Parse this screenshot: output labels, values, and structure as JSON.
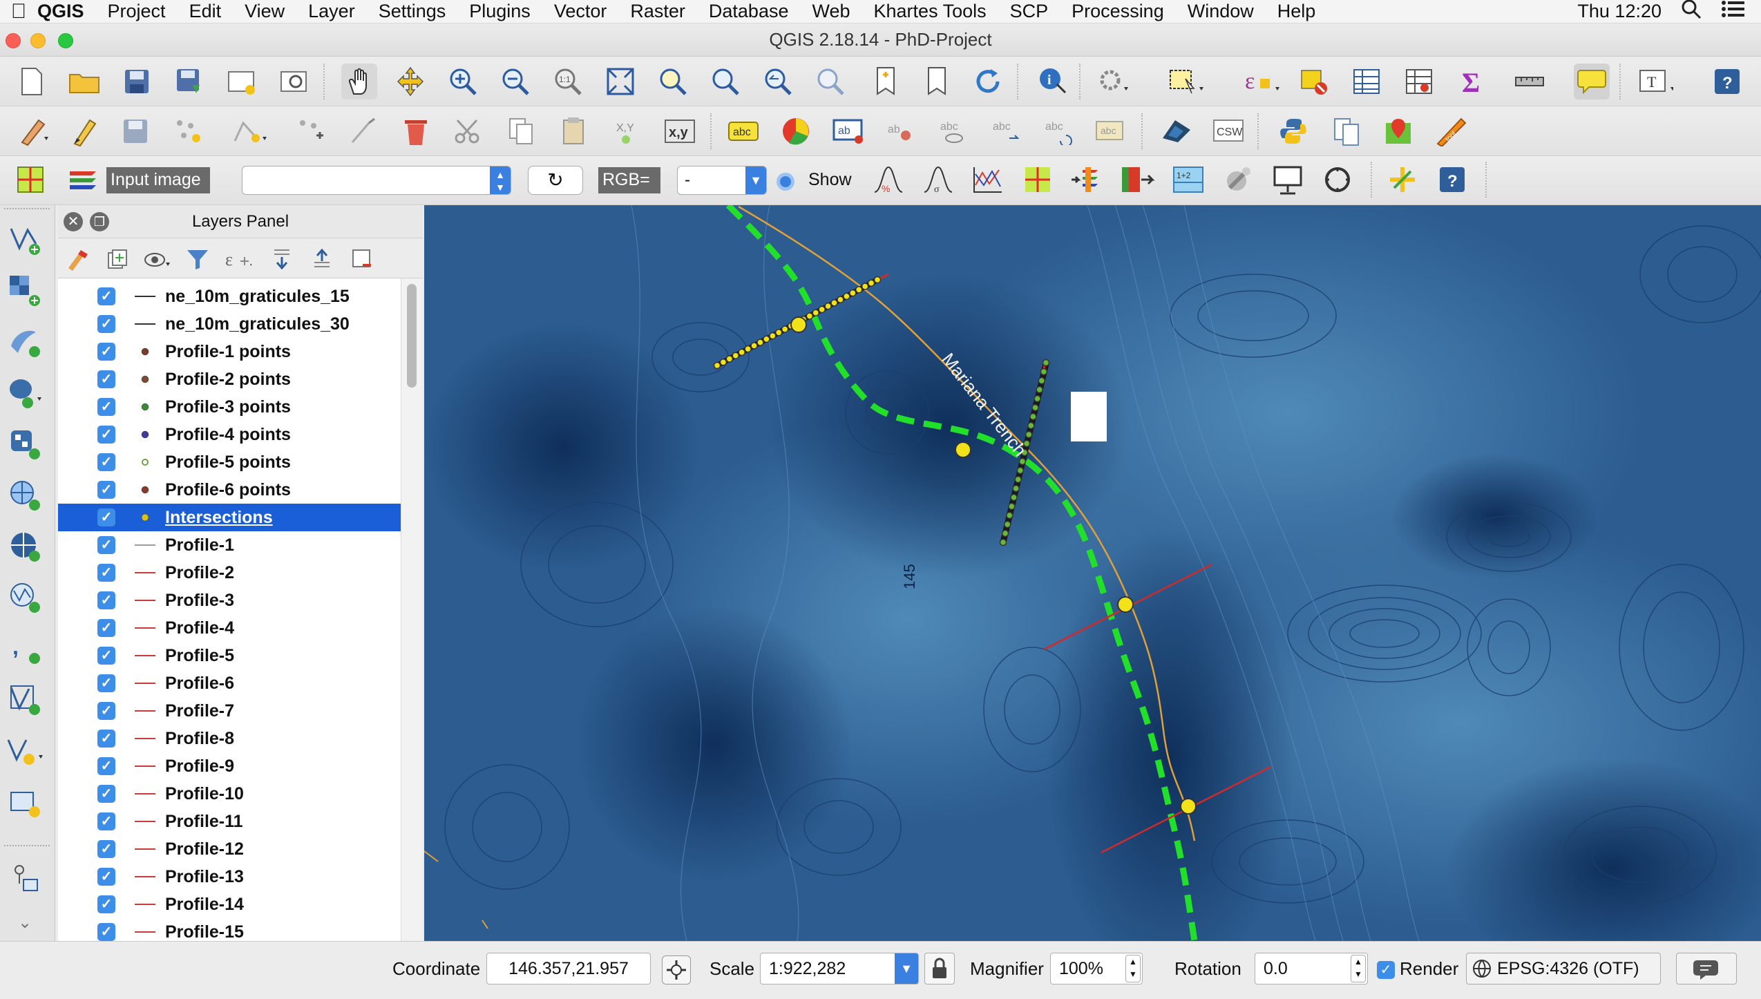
{
  "menubar": {
    "app": "QGIS",
    "items": [
      "Project",
      "Edit",
      "View",
      "Layer",
      "Settings",
      "Plugins",
      "Vector",
      "Raster",
      "Database",
      "Web",
      "Khartes Tools",
      "SCP",
      "Processing",
      "Window",
      "Help"
    ],
    "clock": "Thu 12:20"
  },
  "window": {
    "title": "QGIS 2.18.14 - PhD-Project"
  },
  "scp_toolbar": {
    "input_label": "Input image",
    "input_value": "",
    "rgb_label": "RGB=",
    "rgb_value": "-",
    "show_label": "Show"
  },
  "layers_panel": {
    "title": "Layers Panel",
    "layers": [
      {
        "name": "ne_10m_graticules_15",
        "symbol": "line",
        "color": "#333333",
        "checked": true
      },
      {
        "name": "ne_10m_graticules_30",
        "symbol": "line",
        "color": "#333333",
        "checked": true
      },
      {
        "name": "Profile-1 points",
        "symbol": "point",
        "color": "#7a3b2a",
        "checked": true
      },
      {
        "name": "Profile-2 points",
        "symbol": "point",
        "color": "#7a4a35",
        "checked": true
      },
      {
        "name": "Profile-3 points",
        "symbol": "point",
        "color": "#3a8a3a",
        "checked": true
      },
      {
        "name": "Profile-4 points",
        "symbol": "point",
        "color": "#3d3a9a",
        "checked": true
      },
      {
        "name": "Profile-5 points",
        "symbol": "point-open",
        "color": "#6ea542",
        "checked": true
      },
      {
        "name": "Profile-6 points",
        "symbol": "point",
        "color": "#8a3a2a",
        "checked": true
      },
      {
        "name": "Intersections",
        "symbol": "point",
        "color": "#d9c316",
        "checked": true,
        "selected": true
      },
      {
        "name": "Profile-1",
        "symbol": "line",
        "color": "#9a9a9a",
        "checked": true
      },
      {
        "name": "Profile-2",
        "symbol": "line",
        "color": "#c73a3a",
        "checked": true
      },
      {
        "name": "Profile-3",
        "symbol": "line",
        "color": "#c73a3a",
        "checked": true
      },
      {
        "name": "Profile-4",
        "symbol": "line",
        "color": "#c73a3a",
        "checked": true
      },
      {
        "name": "Profile-5",
        "symbol": "line",
        "color": "#c73a3a",
        "checked": true
      },
      {
        "name": "Profile-6",
        "symbol": "line",
        "color": "#c73a3a",
        "checked": true
      },
      {
        "name": "Profile-7",
        "symbol": "line",
        "color": "#c73a3a",
        "checked": true
      },
      {
        "name": "Profile-8",
        "symbol": "line",
        "color": "#c73a3a",
        "checked": true
      },
      {
        "name": "Profile-9",
        "symbol": "line",
        "color": "#c73a3a",
        "checked": true
      },
      {
        "name": "Profile-10",
        "symbol": "line",
        "color": "#c73a3a",
        "checked": true
      },
      {
        "name": "Profile-11",
        "symbol": "line",
        "color": "#c73a3a",
        "checked": true
      },
      {
        "name": "Profile-12",
        "symbol": "line",
        "color": "#c73a3a",
        "checked": true
      },
      {
        "name": "Profile-13",
        "symbol": "line",
        "color": "#c73a3a",
        "checked": true
      },
      {
        "name": "Profile-14",
        "symbol": "line",
        "color": "#c73a3a",
        "checked": true
      },
      {
        "name": "Profile-15",
        "symbol": "line",
        "color": "#c73a3a",
        "checked": true
      }
    ]
  },
  "map": {
    "trench_label": "Mariana Trench",
    "graticule_label": "145"
  },
  "status": {
    "coordinate_label": "Coordinate",
    "coordinate_value": "146.357,21.957",
    "scale_label": "Scale",
    "scale_value": "1:922,282",
    "magnifier_label": "Magnifier",
    "magnifier_value": "100%",
    "rotation_label": "Rotation",
    "rotation_value": "0.0",
    "render_label": "Render",
    "crs_value": "EPSG:4326 (OTF)"
  },
  "colors": {
    "selection": "#1a5fd7",
    "trench_line": "#22e02a",
    "profile_line": "#d02a2a",
    "intersection": "#f2e21a"
  }
}
